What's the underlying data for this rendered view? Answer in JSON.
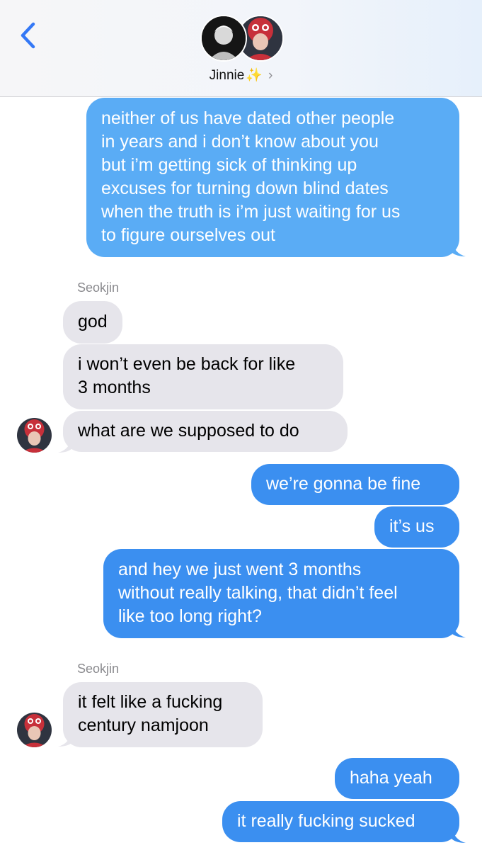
{
  "header": {
    "contact_name": "Jinnie",
    "contact_emoji": "✨",
    "chevron": "›",
    "accent": "#3478f6"
  },
  "colors": {
    "outgoing_bubble": "#3b8ff0",
    "incoming_bubble": "#e6e5eb"
  },
  "messages": [
    {
      "from": "me",
      "lines": [
        "neither of us have dated other people",
        "in years and i don’t know about you",
        "but i’m getting sick of thinking up",
        "excuses for turning down blind dates",
        "when the truth is i’m just waiting for us",
        "to figure ourselves out"
      ]
    },
    {
      "from": "them",
      "sender": "Seokjin",
      "lines": [
        "god"
      ]
    },
    {
      "from": "them",
      "lines": [
        "i won’t even be back for like",
        "3 months"
      ]
    },
    {
      "from": "them",
      "lines": [
        "what are we supposed to do"
      ]
    },
    {
      "from": "me",
      "lines": [
        "we’re gonna be fine"
      ]
    },
    {
      "from": "me",
      "lines": [
        "it’s us"
      ]
    },
    {
      "from": "me",
      "lines": [
        "and hey we just went 3 months",
        "without really talking, that didn’t feel",
        "like too long right?"
      ]
    },
    {
      "from": "them",
      "sender": "Seokjin",
      "lines": [
        "it felt like a fucking",
        "century namjoon"
      ]
    },
    {
      "from": "me",
      "lines": [
        "haha yeah"
      ]
    },
    {
      "from": "me",
      "lines": [
        "it really fucking sucked"
      ]
    }
  ]
}
